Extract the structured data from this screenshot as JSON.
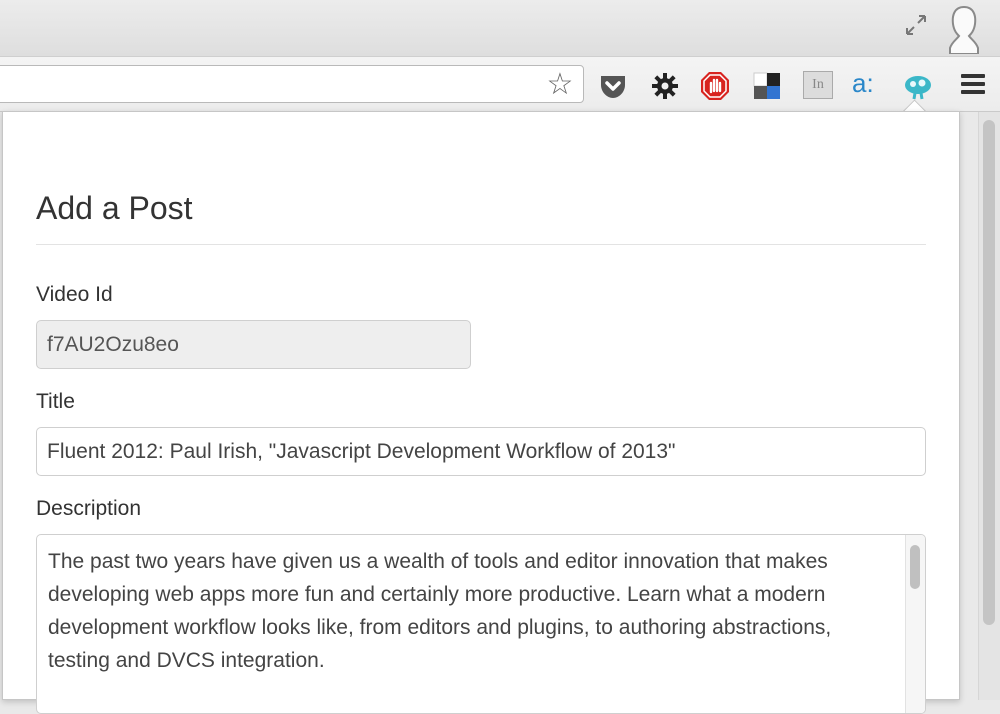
{
  "form": {
    "heading": "Add a Post",
    "video_id": {
      "label": "Video Id",
      "value": "f7AU2Ozu8eo"
    },
    "title": {
      "label": "Title",
      "value": "Fluent 2012: Paul Irish, \"Javascript Development Workflow of 2013\""
    },
    "description": {
      "label": "Description",
      "value": "The past two years have given us a wealth of tools and editor innovation that makes developing web apps more fun and certainly more productive. Learn what a modern development workflow looks like, from editors and plugins, to authoring abstractions, testing and DVCS integration."
    }
  },
  "browser": {
    "extension_icons": [
      "pocket-icon",
      "gear-icon",
      "adblock-icon",
      "delicious-icon",
      "linkedin-icon",
      "amazon-icon",
      "active-extension-icon"
    ],
    "ext_labels": {
      "linkedin": "In",
      "amazon": "a:"
    }
  }
}
